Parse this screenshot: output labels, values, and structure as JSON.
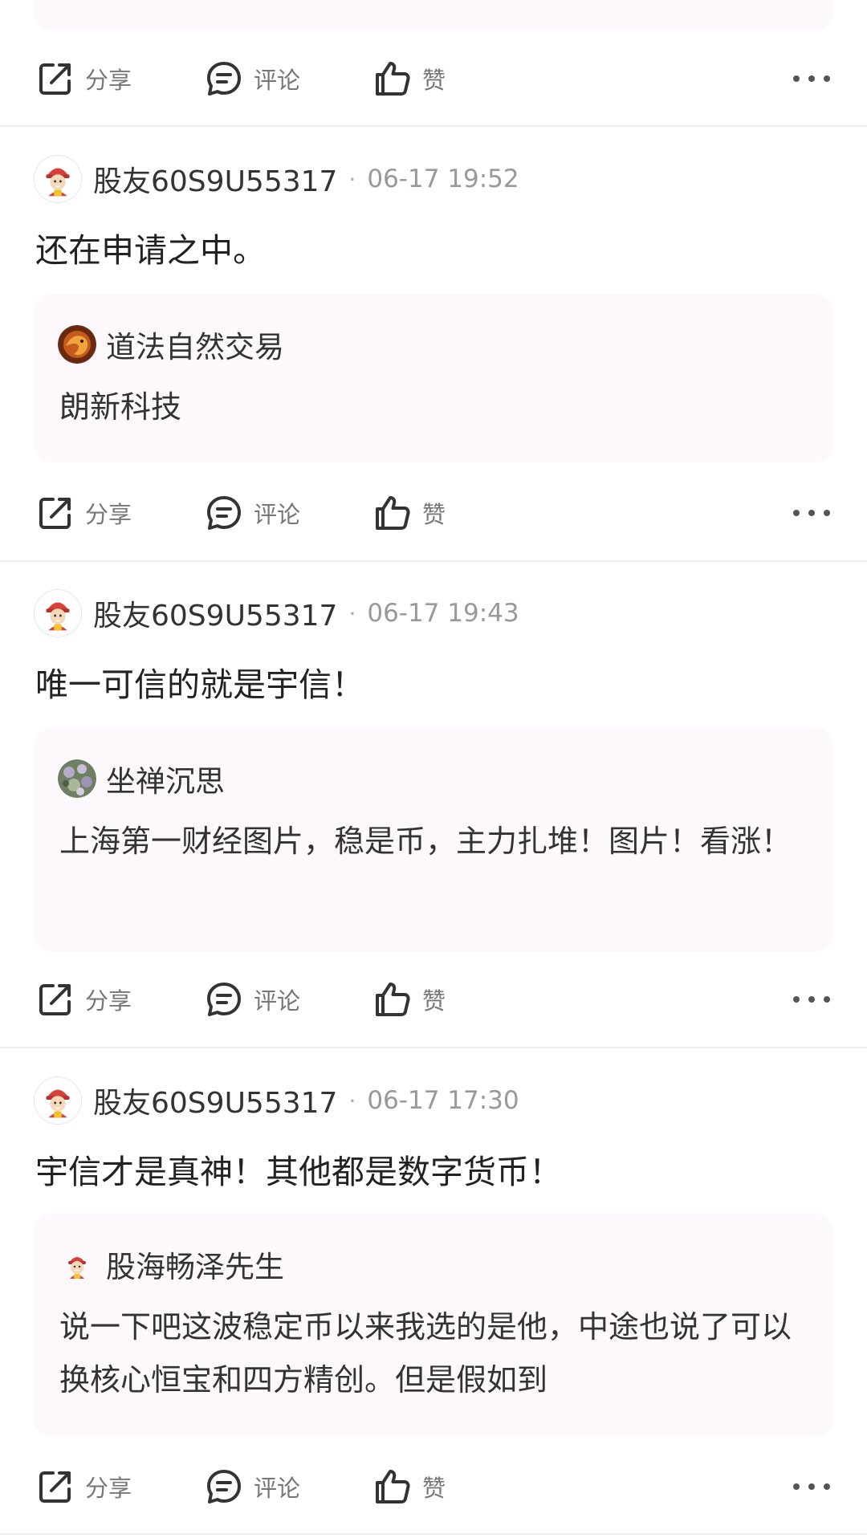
{
  "actions": {
    "share": "分享",
    "comment": "评论",
    "like": "赞",
    "more_icon": "more-horizontal-icon"
  },
  "posts": [
    {
      "username": "股友60S9U55317",
      "separator": "·",
      "time": "06-17 19:52",
      "text": "还在申请之中。",
      "quote": {
        "name": "道法自然交易",
        "text": "朗新科技"
      }
    },
    {
      "username": "股友60S9U55317",
      "separator": "·",
      "time": "06-17 19:43",
      "text": "唯一可信的就是宇信！",
      "quote": {
        "name": "坐禅沉思",
        "text": "上海第一财经图片，稳是币，主力扎堆！图片！看涨！"
      }
    },
    {
      "username": "股友60S9U55317",
      "separator": "·",
      "time": "06-17 17:30",
      "text": "宇信才是真神！其他都是数字货币！",
      "quote": {
        "name": "股海畅泽先生",
        "text": "说一下吧这波稳定币以来我选的是他，中途也说了可以换核心恒宝和四方精创。但是假如到"
      }
    }
  ],
  "colors": {
    "quote_bg": "#fcf8fc",
    "meta_text": "#999999",
    "divider": "#ececec"
  }
}
